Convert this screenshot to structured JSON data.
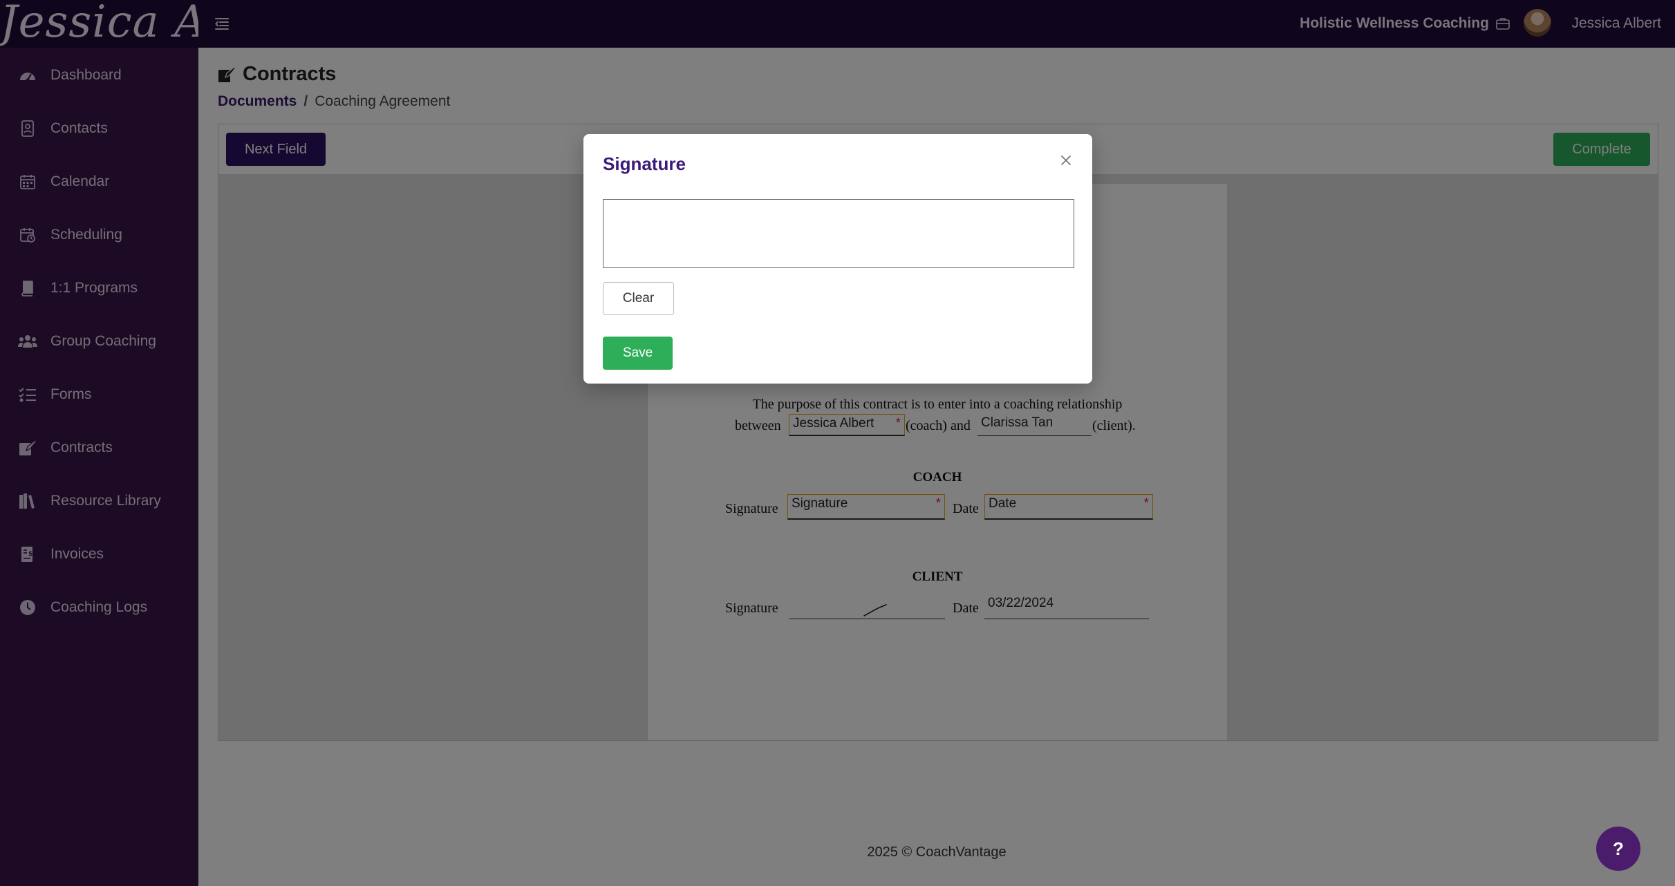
{
  "header": {
    "logo_text": "Jessica Albert",
    "org_name": "Holistic Wellness Coaching",
    "user_name": "Jessica Albert"
  },
  "sidebar": {
    "items": [
      {
        "label": "Dashboard",
        "icon": "dashboard-gauge-icon"
      },
      {
        "label": "Contacts",
        "icon": "contacts-book-icon"
      },
      {
        "label": "Calendar",
        "icon": "calendar-icon"
      },
      {
        "label": "Scheduling",
        "icon": "calendar-clock-icon"
      },
      {
        "label": "1:1 Programs",
        "icon": "book-icon"
      },
      {
        "label": "Group Coaching",
        "icon": "users-icon"
      },
      {
        "label": "Forms",
        "icon": "list-check-icon"
      },
      {
        "label": "Contracts",
        "icon": "file-signature-icon"
      },
      {
        "label": "Resource Library",
        "icon": "books-icon"
      },
      {
        "label": "Invoices",
        "icon": "invoice-icon"
      },
      {
        "label": "Coaching Logs",
        "icon": "clock-icon"
      }
    ]
  },
  "page": {
    "title": "Contracts",
    "breadcrumb": {
      "parent": "Documents",
      "separator": "/",
      "current": "Coaching Agreement"
    }
  },
  "toolbar": {
    "next_field_label": "Next Field",
    "complete_label": "Complete"
  },
  "document": {
    "para_line1": "The purpose of this contract is to enter into a coaching relationship",
    "para_between": "between",
    "coach_name_value": "Jessica Albert",
    "coach_suffix": "(coach) and",
    "client_name_value": "Clarissa Tan",
    "client_suffix": "(client).",
    "coach_heading": "COACH",
    "client_heading": "CLIENT",
    "signature_label": "Signature",
    "date_label": "Date",
    "coach_signature_placeholder": "Signature",
    "coach_date_placeholder": "Date",
    "client_date_value": "03/22/2024",
    "required_mark": "*"
  },
  "modal": {
    "title": "Signature",
    "clear_label": "Clear",
    "save_label": "Save"
  },
  "footer": {
    "text": "2025 © CoachVantage"
  },
  "help": {
    "label": "?"
  },
  "colors": {
    "topbar": "#1e0b3a",
    "sidebar": "#3b1448",
    "primary_button": "#2b1263",
    "success_button": "#2fae5a",
    "field_highlight": "#e6a21c",
    "required": "#e0252a"
  }
}
